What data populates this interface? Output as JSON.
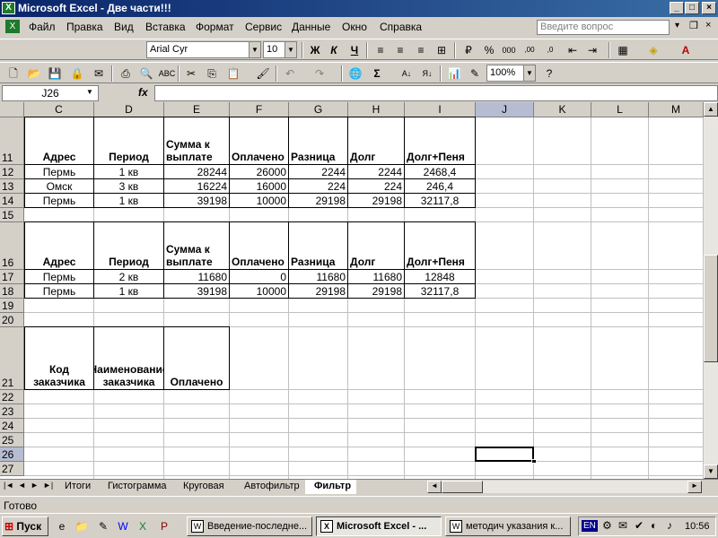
{
  "window": {
    "title": "Microsoft Excel - Две части!!!"
  },
  "menu": {
    "items": [
      "Файл",
      "Правка",
      "Вид",
      "Вставка",
      "Формат",
      "Сервис",
      "Данные",
      "Окно",
      "Справка"
    ],
    "help_placeholder": "Введите вопрос"
  },
  "toolbar": {
    "font": "Arial Cyr",
    "size": "10",
    "zoom": "100%"
  },
  "formula": {
    "namebox": "J26",
    "fx": "fx",
    "value": ""
  },
  "columns": [
    "C",
    "D",
    "E",
    "F",
    "G",
    "H",
    "I",
    "J",
    "K",
    "L",
    "M"
  ],
  "rows": [
    "11",
    "12",
    "13",
    "14",
    "15",
    "16",
    "17",
    "18",
    "19",
    "20",
    "21",
    "22",
    "23",
    "24",
    "25",
    "26",
    "27"
  ],
  "table1": {
    "headers": [
      "Адрес",
      "Период",
      "Сумма к выплате",
      "Оплачено",
      "Разница",
      "Долг",
      "Долг+Пеня"
    ],
    "rows": [
      [
        "Пермь",
        "1 кв",
        "28244",
        "26000",
        "2244",
        "2244",
        "2468,4"
      ],
      [
        "Омск",
        "3 кв",
        "16224",
        "16000",
        "224",
        "224",
        "246,4"
      ],
      [
        "Пермь",
        "1 кв",
        "39198",
        "10000",
        "29198",
        "29198",
        "32117,8"
      ]
    ]
  },
  "table2": {
    "headers": [
      "Адрес",
      "Период",
      "Сумма к выплате",
      "Оплачено",
      "Разница",
      "Долг",
      "Долг+Пеня"
    ],
    "rows": [
      [
        "Пермь",
        "2 кв",
        "11680",
        "0",
        "11680",
        "11680",
        "12848"
      ],
      [
        "Пермь",
        "1 кв",
        "39198",
        "10000",
        "29198",
        "29198",
        "32117,8"
      ]
    ]
  },
  "table3": {
    "headers": [
      "Код заказчика",
      "Наименование заказчика",
      "Оплачено"
    ]
  },
  "sheet_tabs": [
    "Итоги",
    "Гистограмма",
    "Круговая",
    "Автофильтр",
    "Фильтр"
  ],
  "active_tab": "Фильтр",
  "status": {
    "text": "Готово"
  },
  "taskbar": {
    "start": "Пуск",
    "buttons": [
      "Введение-последне...",
      "Microsoft Excel - ...",
      "методич указания к..."
    ],
    "lang": "EN",
    "clock": "10:56"
  }
}
